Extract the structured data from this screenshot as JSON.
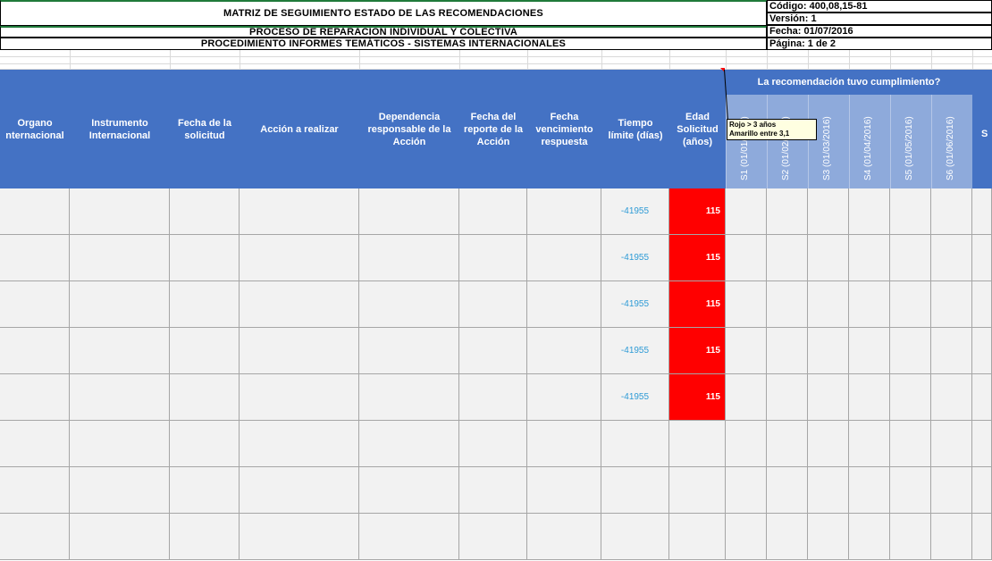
{
  "header": {
    "title": "MATRIZ DE SEGUIMIENTO ESTADO DE LAS RECOMENDACIONES",
    "process": "PROCESO DE REPARACIÓN INDIVIDUAL Y COLECTIVA",
    "procedure": "PROCEDIMIENTO INFORMES TEMÁTICOS - SISTEMAS INTERNACIONALES",
    "codigo": "Código: 400,08,15-81",
    "version": "Versión: 1",
    "fecha": "Fecha: 01/07/2016",
    "pagina": "Página: 1 de 2"
  },
  "columns": {
    "organo": "Organo\nnternacional",
    "instrumento": "Instrumento\nInternacional",
    "fecha_solicitud": "Fecha de la\nsolicitud",
    "accion": "Acción a realizar",
    "dependencia": "Dependencia\nresponsable de la\nAcción",
    "fecha_reporte": "Fecha del\nreporte de la\nAcción",
    "fecha_vencimiento": "Fecha\nvencimiento\nrespuesta",
    "tiempo_limite": "Tiempo\nlímite (días)",
    "edad": "Edad\nSolicitud\n(años)",
    "cumplimiento_group": "La recomendación tuvo cumplimiento?",
    "sub": [
      "S1 (01/01/2016)",
      "S2 (01/02/2016)",
      "S3 (01/03/2016)",
      "S4 (01/04/2016)",
      "S5 (01/05/2016)",
      "S6 (01/06/2016)"
    ],
    "cut_s": "S"
  },
  "comment": {
    "text": "Rojo > 3 años\nAmarillo entre 3,1"
  },
  "rows": [
    {
      "tiempo": "-41955",
      "edad": "115"
    },
    {
      "tiempo": "-41955",
      "edad": "115"
    },
    {
      "tiempo": "-41955",
      "edad": "115"
    },
    {
      "tiempo": "-41955",
      "edad": "115"
    },
    {
      "tiempo": "-41955",
      "edad": "115"
    },
    {
      "tiempo": "",
      "edad": ""
    },
    {
      "tiempo": "",
      "edad": ""
    },
    {
      "tiempo": "",
      "edad": ""
    }
  ],
  "colors": {
    "header_blue": "#4472c4",
    "sub_header": "#8eaadb",
    "alert_red": "#ff0000",
    "tiempo_text": "#2e9bd6"
  }
}
